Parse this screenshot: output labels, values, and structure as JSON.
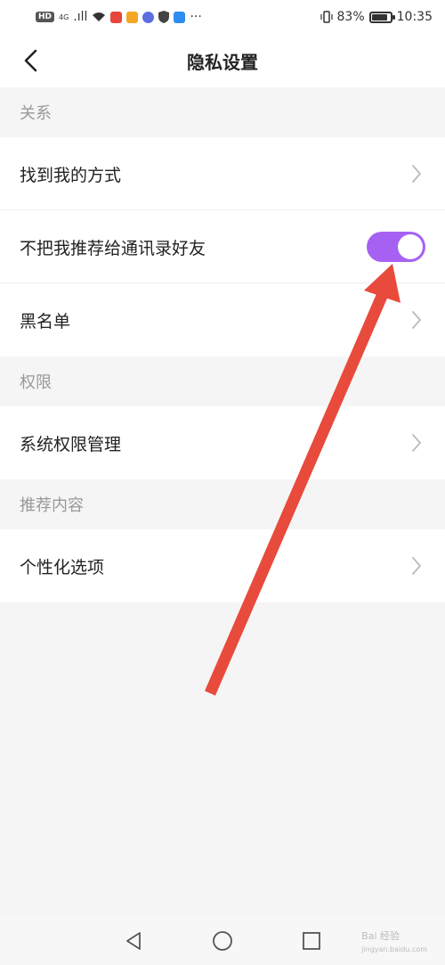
{
  "status_bar": {
    "net_tag": "HD",
    "net_small": "4G",
    "signal_text": ".ıll",
    "more": "···",
    "battery_percent": "83%",
    "battery_level": 0.83,
    "time": "10:35"
  },
  "header": {
    "title": "隐私设置"
  },
  "sections": {
    "relations": "关系",
    "permissions": "权限",
    "recommend": "推荐内容"
  },
  "rows": {
    "find_me": "找到我的方式",
    "no_recommend": "不把我推荐给通讯录好友",
    "blacklist": "黑名单",
    "system_permissions": "系统权限管理",
    "personalization": "个性化选项"
  },
  "toggle": {
    "on": true,
    "color": "#a661f2"
  },
  "annotation": {
    "arrow_color": "#e84a3c"
  },
  "watermark": {
    "text": "Bai 经验",
    "sub": "jingyan.baidu.com"
  }
}
